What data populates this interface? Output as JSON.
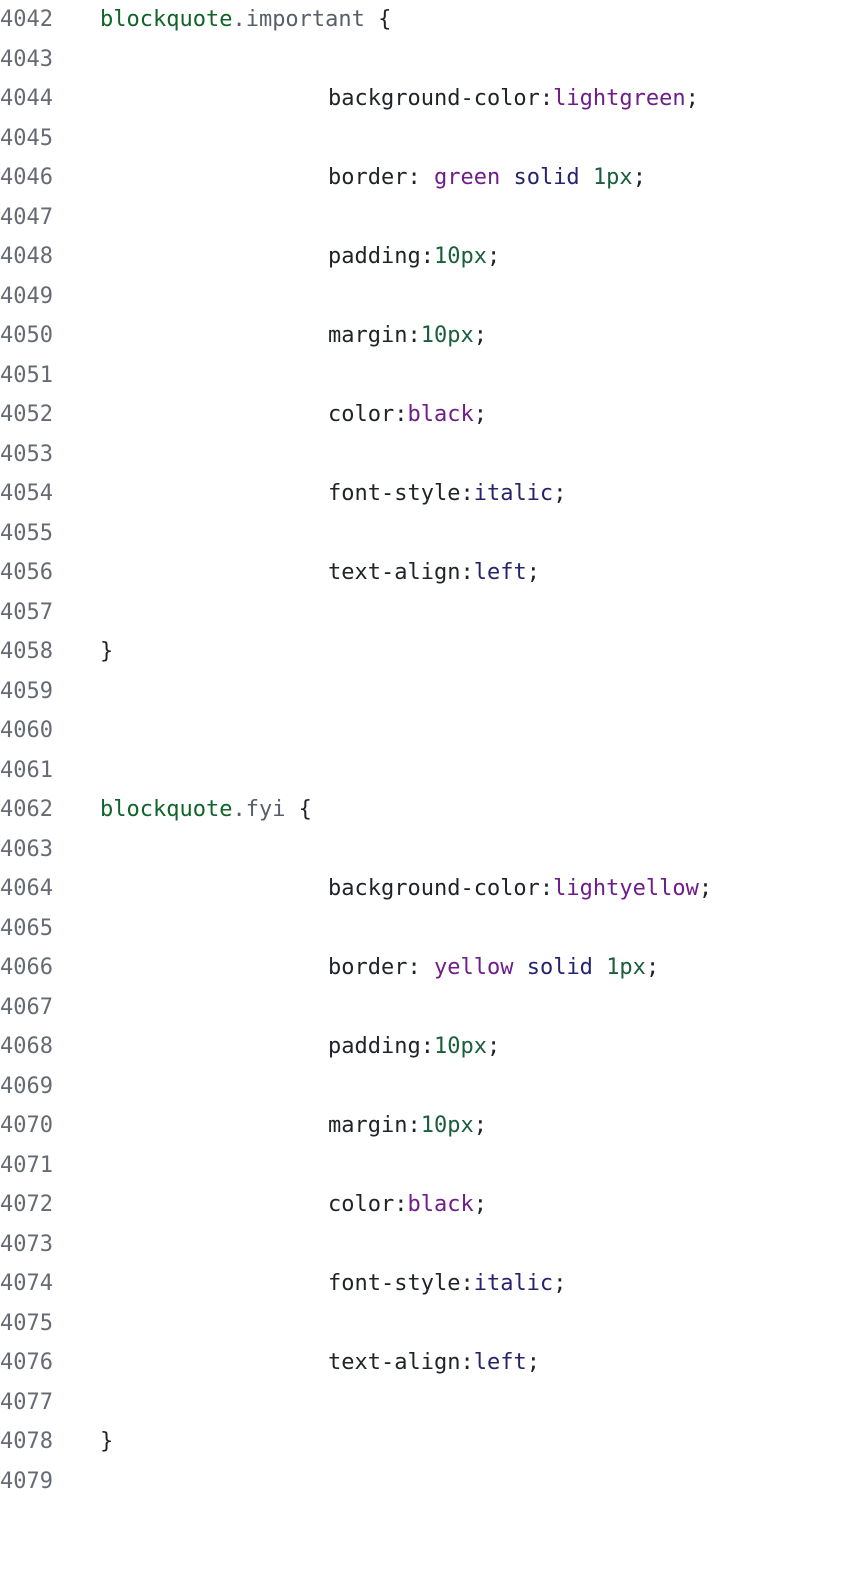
{
  "lines": [
    {
      "num": "4042",
      "tokens": [
        {
          "t": "blockquote",
          "c": "selector"
        },
        {
          "t": ".important",
          "c": "class"
        },
        {
          "t": " {",
          "c": "punct"
        }
      ],
      "indent": 0
    },
    {
      "num": "4043",
      "tokens": [],
      "indent": 0
    },
    {
      "num": "4044",
      "tokens": [
        {
          "t": "background-color:",
          "c": "prop"
        },
        {
          "t": "lightgreen",
          "c": "color"
        },
        {
          "t": ";",
          "c": "punct"
        }
      ],
      "indent": 1
    },
    {
      "num": "4045",
      "tokens": [],
      "indent": 0
    },
    {
      "num": "4046",
      "tokens": [
        {
          "t": "border: ",
          "c": "prop"
        },
        {
          "t": "green",
          "c": "color"
        },
        {
          "t": " ",
          "c": "punct"
        },
        {
          "t": "solid",
          "c": "keyword"
        },
        {
          "t": " ",
          "c": "punct"
        },
        {
          "t": "1px",
          "c": "number"
        },
        {
          "t": ";",
          "c": "punct"
        }
      ],
      "indent": 1
    },
    {
      "num": "4047",
      "tokens": [],
      "indent": 0
    },
    {
      "num": "4048",
      "tokens": [
        {
          "t": "padding:",
          "c": "prop"
        },
        {
          "t": "10px",
          "c": "number"
        },
        {
          "t": ";",
          "c": "punct"
        }
      ],
      "indent": 1
    },
    {
      "num": "4049",
      "tokens": [],
      "indent": 0
    },
    {
      "num": "4050",
      "tokens": [
        {
          "t": "margin:",
          "c": "prop"
        },
        {
          "t": "10px",
          "c": "number"
        },
        {
          "t": ";",
          "c": "punct"
        }
      ],
      "indent": 1
    },
    {
      "num": "4051",
      "tokens": [],
      "indent": 0
    },
    {
      "num": "4052",
      "tokens": [
        {
          "t": "color:",
          "c": "prop"
        },
        {
          "t": "black",
          "c": "color"
        },
        {
          "t": ";",
          "c": "punct"
        }
      ],
      "indent": 1
    },
    {
      "num": "4053",
      "tokens": [],
      "indent": 0
    },
    {
      "num": "4054",
      "tokens": [
        {
          "t": "font-style:",
          "c": "prop"
        },
        {
          "t": "italic",
          "c": "keyword"
        },
        {
          "t": ";",
          "c": "punct"
        }
      ],
      "indent": 1
    },
    {
      "num": "4055",
      "tokens": [],
      "indent": 0
    },
    {
      "num": "4056",
      "tokens": [
        {
          "t": "text-align:",
          "c": "prop"
        },
        {
          "t": "left",
          "c": "keyword"
        },
        {
          "t": ";",
          "c": "punct"
        }
      ],
      "indent": 1
    },
    {
      "num": "4057",
      "tokens": [],
      "indent": 0
    },
    {
      "num": "4058",
      "tokens": [
        {
          "t": "}",
          "c": "punct"
        }
      ],
      "indent": 0
    },
    {
      "num": "4059",
      "tokens": [],
      "indent": 0
    },
    {
      "num": "4060",
      "tokens": [],
      "indent": 0
    },
    {
      "num": "4061",
      "tokens": [],
      "indent": 0
    },
    {
      "num": "4062",
      "tokens": [
        {
          "t": "blockquote",
          "c": "selector"
        },
        {
          "t": ".fyi",
          "c": "class"
        },
        {
          "t": " {",
          "c": "punct"
        }
      ],
      "indent": 0
    },
    {
      "num": "4063",
      "tokens": [],
      "indent": 0
    },
    {
      "num": "4064",
      "tokens": [
        {
          "t": "background-color:",
          "c": "prop"
        },
        {
          "t": "lightyellow",
          "c": "color"
        },
        {
          "t": ";",
          "c": "punct"
        }
      ],
      "indent": 1
    },
    {
      "num": "4065",
      "tokens": [],
      "indent": 0
    },
    {
      "num": "4066",
      "tokens": [
        {
          "t": "border: ",
          "c": "prop"
        },
        {
          "t": "yellow",
          "c": "color"
        },
        {
          "t": " ",
          "c": "punct"
        },
        {
          "t": "solid",
          "c": "keyword"
        },
        {
          "t": " ",
          "c": "punct"
        },
        {
          "t": "1px",
          "c": "number"
        },
        {
          "t": ";",
          "c": "punct"
        }
      ],
      "indent": 1
    },
    {
      "num": "4067",
      "tokens": [],
      "indent": 0
    },
    {
      "num": "4068",
      "tokens": [
        {
          "t": "padding:",
          "c": "prop"
        },
        {
          "t": "10px",
          "c": "number"
        },
        {
          "t": ";",
          "c": "punct"
        }
      ],
      "indent": 1
    },
    {
      "num": "4069",
      "tokens": [],
      "indent": 0
    },
    {
      "num": "4070",
      "tokens": [
        {
          "t": "margin:",
          "c": "prop"
        },
        {
          "t": "10px",
          "c": "number"
        },
        {
          "t": ";",
          "c": "punct"
        }
      ],
      "indent": 1
    },
    {
      "num": "4071",
      "tokens": [],
      "indent": 0
    },
    {
      "num": "4072",
      "tokens": [
        {
          "t": "color:",
          "c": "prop"
        },
        {
          "t": "black",
          "c": "color"
        },
        {
          "t": ";",
          "c": "punct"
        }
      ],
      "indent": 1
    },
    {
      "num": "4073",
      "tokens": [],
      "indent": 0
    },
    {
      "num": "4074",
      "tokens": [
        {
          "t": "font-style:",
          "c": "prop"
        },
        {
          "t": "italic",
          "c": "keyword"
        },
        {
          "t": ";",
          "c": "punct"
        }
      ],
      "indent": 1
    },
    {
      "num": "4075",
      "tokens": [],
      "indent": 0
    },
    {
      "num": "4076",
      "tokens": [
        {
          "t": "text-align:",
          "c": "prop"
        },
        {
          "t": "left",
          "c": "keyword"
        },
        {
          "t": ";",
          "c": "punct"
        }
      ],
      "indent": 1
    },
    {
      "num": "4077",
      "tokens": [],
      "indent": 0
    },
    {
      "num": "4078",
      "tokens": [
        {
          "t": "}",
          "c": "punct"
        }
      ],
      "indent": 0
    },
    {
      "num": "4079",
      "tokens": [],
      "indent": 0
    }
  ],
  "colors": {
    "background": "#ffffff",
    "line_number": "#666a73",
    "selector": "#116329",
    "class": "#57606a",
    "color_value": "#6f1d8a",
    "number": "#1a5e3c",
    "keyword": "#25236e",
    "text": "#1f2328"
  }
}
